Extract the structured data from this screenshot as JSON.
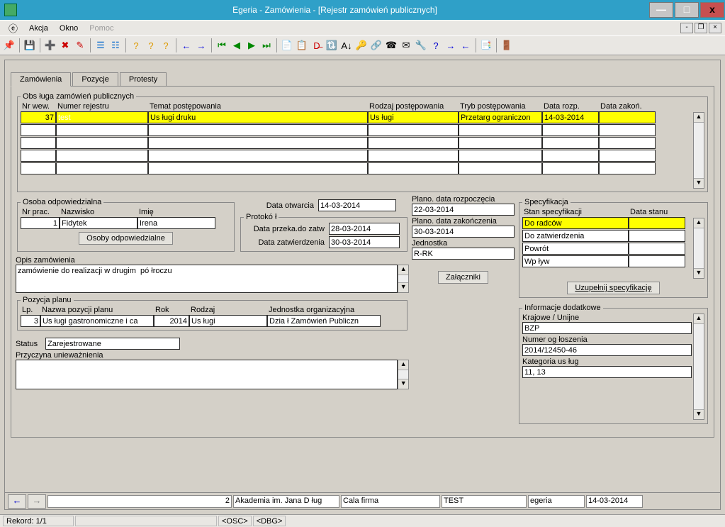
{
  "title": "Egeria - Zamówienia - [Rejestr zamówień publicznych]",
  "menu": {
    "akcja": "Akcja",
    "okno": "Okno",
    "pomoc": "Pomoc"
  },
  "tabs": {
    "zamowienia": "Zamówienia",
    "pozycje": "Pozycje",
    "protesty": "Protesty"
  },
  "group_main": {
    "legend": "Obs ługa zamówień publicznych",
    "headers": {
      "nrwew": "Nr wew.",
      "nrrej": "Numer rejestru",
      "temat": "Temat postępowania",
      "rodzaj": "Rodzaj postępowania",
      "tryb": "Tryb postępowania",
      "drozp": "Data rozp.",
      "dzak": "Data zakoń."
    },
    "row": {
      "nrwew": "37",
      "nrrej": "test",
      "temat": "Us ługi druku",
      "rodzaj": "Us ługi",
      "tryb": "Przetarg ograniczon",
      "drozp": "14-03-2014",
      "dzak": ""
    }
  },
  "osoba": {
    "legend": "Osoba odpowiedzialna",
    "hdr": {
      "nrprac": "Nr prac.",
      "nazwisko": "Nazwisko",
      "imie": "Imię"
    },
    "val": {
      "nrprac": "1",
      "nazwisko": "Fidytek",
      "imie": "Irena"
    },
    "btn": "Osoby odpowiedzialne"
  },
  "dates": {
    "otwarcia_lbl": "Data otwarcia",
    "otwarcia": "14-03-2014",
    "protokol_legend": "Protokó ł",
    "przek_lbl": "Data przeka.do zatw",
    "przek": "28-03-2014",
    "zatw_lbl": "Data zatwierdzenia",
    "zatw": "30-03-2014"
  },
  "plano": {
    "rozp_lbl": "Plano. data rozpoczęcia",
    "rozp": "22-03-2014",
    "zak_lbl": "Plano. data zakończenia",
    "zak": "30-03-2014",
    "jedn_lbl": "Jednostka",
    "jedn": "R-RK",
    "zalaczniki_btn": "Załączniki"
  },
  "spec": {
    "legend": "Specyfikacja",
    "hdr": {
      "stan": "Stan specyfikacji",
      "data": "Data stanu"
    },
    "rows": [
      {
        "stan": "Do radców",
        "data": ""
      },
      {
        "stan": "Do zatwierdzenia",
        "data": ""
      },
      {
        "stan": "Powrót",
        "data": ""
      },
      {
        "stan": "Wp ływ",
        "data": ""
      }
    ],
    "btn": "Uzupełnij specyfikację"
  },
  "opis": {
    "lbl": "Opis zamówienia",
    "val": "zamówienie do realizacji w drugim  pó łroczu"
  },
  "pozycja": {
    "legend": "Pozycja planu",
    "hdr": {
      "lp": "Lp.",
      "nazwa": "Nazwa pozycji planu",
      "rok": "Rok",
      "rodzaj": "Rodzaj",
      "jedn": "Jednostka organizacyjna"
    },
    "val": {
      "lp": "3",
      "nazwa": "Us ługi gastronomiczne i ca",
      "rok": "2014",
      "rodzaj": "Us ługi",
      "jedn": "Dzia ł Zamówień Publiczn"
    }
  },
  "status": {
    "lbl": "Status",
    "val": "Zarejestrowane"
  },
  "przyczyna": {
    "lbl": "Przyczyna unieważnienia",
    "val": ""
  },
  "info": {
    "legend": "Informacje dodatkowe",
    "kraj_lbl": "Krajowe / Unijne",
    "kraj": "BZP",
    "ogl_lbl": "Numer og łoszenia",
    "ogl": "2014/12450-46",
    "kat_lbl": "Kategoria us ług",
    "kat": "11, 13"
  },
  "statusbar": {
    "pg": "2",
    "org": "Akademia im. Jana D ług",
    "firma": "Cala firma",
    "env": "TEST",
    "user": "egeria",
    "date": "14-03-2014"
  },
  "bottom": {
    "rekord": "Rekord: 1/1",
    "osc": "<OSC>",
    "dbg": "<DBG>"
  }
}
